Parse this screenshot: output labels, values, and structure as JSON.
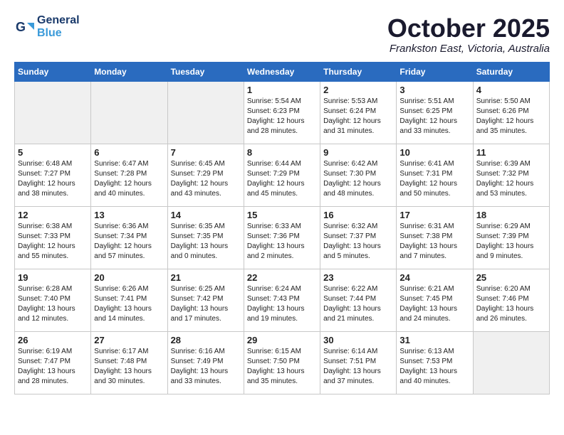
{
  "logo": {
    "line1": "General",
    "line2": "Blue"
  },
  "title": "October 2025",
  "subtitle": "Frankston East, Victoria, Australia",
  "headers": [
    "Sunday",
    "Monday",
    "Tuesday",
    "Wednesday",
    "Thursday",
    "Friday",
    "Saturday"
  ],
  "weeks": [
    [
      {
        "num": "",
        "info": ""
      },
      {
        "num": "",
        "info": ""
      },
      {
        "num": "",
        "info": ""
      },
      {
        "num": "1",
        "info": "Sunrise: 5:54 AM\nSunset: 6:23 PM\nDaylight: 12 hours\nand 28 minutes."
      },
      {
        "num": "2",
        "info": "Sunrise: 5:53 AM\nSunset: 6:24 PM\nDaylight: 12 hours\nand 31 minutes."
      },
      {
        "num": "3",
        "info": "Sunrise: 5:51 AM\nSunset: 6:25 PM\nDaylight: 12 hours\nand 33 minutes."
      },
      {
        "num": "4",
        "info": "Sunrise: 5:50 AM\nSunset: 6:26 PM\nDaylight: 12 hours\nand 35 minutes."
      }
    ],
    [
      {
        "num": "5",
        "info": "Sunrise: 6:48 AM\nSunset: 7:27 PM\nDaylight: 12 hours\nand 38 minutes."
      },
      {
        "num": "6",
        "info": "Sunrise: 6:47 AM\nSunset: 7:28 PM\nDaylight: 12 hours\nand 40 minutes."
      },
      {
        "num": "7",
        "info": "Sunrise: 6:45 AM\nSunset: 7:29 PM\nDaylight: 12 hours\nand 43 minutes."
      },
      {
        "num": "8",
        "info": "Sunrise: 6:44 AM\nSunset: 7:29 PM\nDaylight: 12 hours\nand 45 minutes."
      },
      {
        "num": "9",
        "info": "Sunrise: 6:42 AM\nSunset: 7:30 PM\nDaylight: 12 hours\nand 48 minutes."
      },
      {
        "num": "10",
        "info": "Sunrise: 6:41 AM\nSunset: 7:31 PM\nDaylight: 12 hours\nand 50 minutes."
      },
      {
        "num": "11",
        "info": "Sunrise: 6:39 AM\nSunset: 7:32 PM\nDaylight: 12 hours\nand 53 minutes."
      }
    ],
    [
      {
        "num": "12",
        "info": "Sunrise: 6:38 AM\nSunset: 7:33 PM\nDaylight: 12 hours\nand 55 minutes."
      },
      {
        "num": "13",
        "info": "Sunrise: 6:36 AM\nSunset: 7:34 PM\nDaylight: 12 hours\nand 57 minutes."
      },
      {
        "num": "14",
        "info": "Sunrise: 6:35 AM\nSunset: 7:35 PM\nDaylight: 13 hours\nand 0 minutes."
      },
      {
        "num": "15",
        "info": "Sunrise: 6:33 AM\nSunset: 7:36 PM\nDaylight: 13 hours\nand 2 minutes."
      },
      {
        "num": "16",
        "info": "Sunrise: 6:32 AM\nSunset: 7:37 PM\nDaylight: 13 hours\nand 5 minutes."
      },
      {
        "num": "17",
        "info": "Sunrise: 6:31 AM\nSunset: 7:38 PM\nDaylight: 13 hours\nand 7 minutes."
      },
      {
        "num": "18",
        "info": "Sunrise: 6:29 AM\nSunset: 7:39 PM\nDaylight: 13 hours\nand 9 minutes."
      }
    ],
    [
      {
        "num": "19",
        "info": "Sunrise: 6:28 AM\nSunset: 7:40 PM\nDaylight: 13 hours\nand 12 minutes."
      },
      {
        "num": "20",
        "info": "Sunrise: 6:26 AM\nSunset: 7:41 PM\nDaylight: 13 hours\nand 14 minutes."
      },
      {
        "num": "21",
        "info": "Sunrise: 6:25 AM\nSunset: 7:42 PM\nDaylight: 13 hours\nand 17 minutes."
      },
      {
        "num": "22",
        "info": "Sunrise: 6:24 AM\nSunset: 7:43 PM\nDaylight: 13 hours\nand 19 minutes."
      },
      {
        "num": "23",
        "info": "Sunrise: 6:22 AM\nSunset: 7:44 PM\nDaylight: 13 hours\nand 21 minutes."
      },
      {
        "num": "24",
        "info": "Sunrise: 6:21 AM\nSunset: 7:45 PM\nDaylight: 13 hours\nand 24 minutes."
      },
      {
        "num": "25",
        "info": "Sunrise: 6:20 AM\nSunset: 7:46 PM\nDaylight: 13 hours\nand 26 minutes."
      }
    ],
    [
      {
        "num": "26",
        "info": "Sunrise: 6:19 AM\nSunset: 7:47 PM\nDaylight: 13 hours\nand 28 minutes."
      },
      {
        "num": "27",
        "info": "Sunrise: 6:17 AM\nSunset: 7:48 PM\nDaylight: 13 hours\nand 30 minutes."
      },
      {
        "num": "28",
        "info": "Sunrise: 6:16 AM\nSunset: 7:49 PM\nDaylight: 13 hours\nand 33 minutes."
      },
      {
        "num": "29",
        "info": "Sunrise: 6:15 AM\nSunset: 7:50 PM\nDaylight: 13 hours\nand 35 minutes."
      },
      {
        "num": "30",
        "info": "Sunrise: 6:14 AM\nSunset: 7:51 PM\nDaylight: 13 hours\nand 37 minutes."
      },
      {
        "num": "31",
        "info": "Sunrise: 6:13 AM\nSunset: 7:53 PM\nDaylight: 13 hours\nand 40 minutes."
      },
      {
        "num": "",
        "info": ""
      }
    ]
  ]
}
